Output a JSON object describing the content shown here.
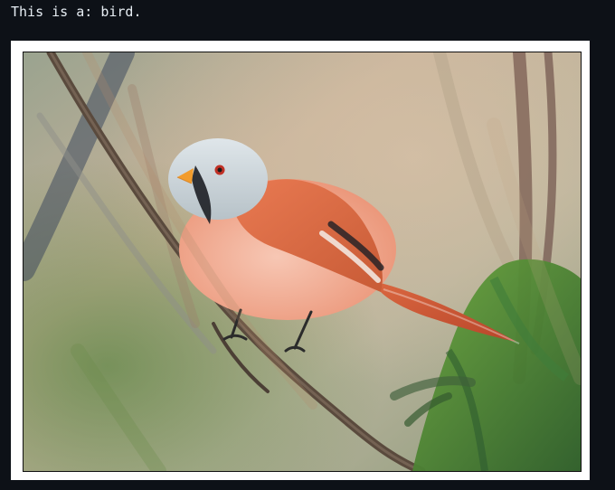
{
  "output": {
    "text": "This is a: bird."
  },
  "image": {
    "subject": "bird-photo",
    "colors": {
      "background_soft": "#a7a88f",
      "background_warm": "#c7b39a",
      "bird_breast": "#f2b29c",
      "bird_wing": "#e46b43",
      "bird_head": "#c9d3d8",
      "moss": "#4c8f33",
      "branch": "#5a4a3d"
    }
  }
}
